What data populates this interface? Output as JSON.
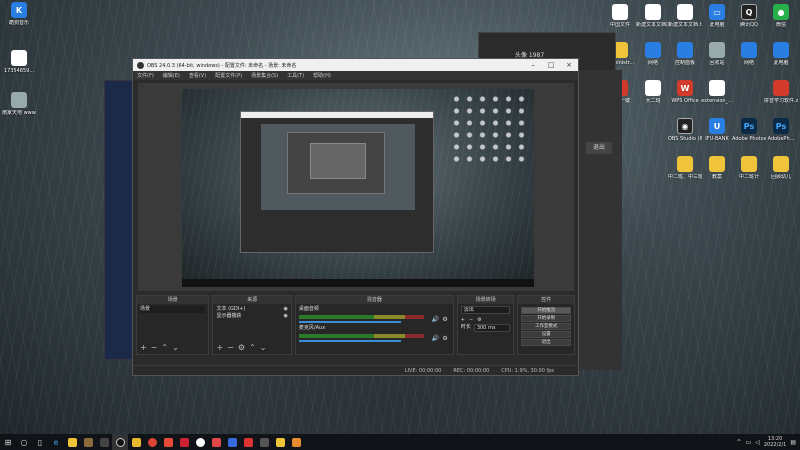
{
  "desktop": {
    "left_icons": [
      {
        "name": "kugou-icon",
        "label": "酷狗音乐",
        "glyph": "K",
        "style": "g-blue"
      },
      {
        "name": "file-icon",
        "label": "17354859...",
        "glyph": "",
        "style": "g-doc"
      },
      {
        "name": "image-icon",
        "label": "雨家天地 www.dyfl...",
        "glyph": "",
        "style": "g-gray"
      }
    ],
    "right_icons": [
      {
        "name": "doc1",
        "label": "中国文件",
        "glyph": "",
        "style": "g-doc"
      },
      {
        "name": "doc2",
        "label": "新建文本文档(3).txt",
        "glyph": "",
        "style": "g-doc"
      },
      {
        "name": "doc3",
        "label": "新建文本文档.txt",
        "glyph": "",
        "style": "g-doc"
      },
      {
        "name": "pc",
        "label": "此电脑",
        "glyph": "▭",
        "style": "g-blue"
      },
      {
        "name": "qq",
        "label": "腾讯QQ",
        "glyph": "Q",
        "style": "g-dark"
      },
      {
        "name": "wechat",
        "label": "微信",
        "glyph": "●",
        "style": "g-green"
      },
      {
        "name": "ws1",
        "label": "Administr...",
        "glyph": "",
        "style": "g-yellow"
      },
      {
        "name": "ws2",
        "label": "网络",
        "glyph": "",
        "style": "g-blue"
      },
      {
        "name": "ws3",
        "label": "控制面板",
        "glyph": "",
        "style": "g-blue"
      },
      {
        "name": "ws4",
        "label": "回收站",
        "glyph": "",
        "style": "g-gray"
      },
      {
        "name": "ws5",
        "label": "网络",
        "glyph": "",
        "style": "g-blue"
      },
      {
        "name": "ws6",
        "label": "此电脑",
        "glyph": "",
        "style": "g-blue"
      },
      {
        "name": "ws7",
        "label": "小白一键",
        "glyph": "",
        "style": "g-red"
      },
      {
        "name": "ws8",
        "label": "大二班",
        "glyph": "",
        "style": "g-doc"
      },
      {
        "name": "ws9",
        "label": "WPS Office",
        "glyph": "W",
        "style": "g-red"
      },
      {
        "name": "ws10",
        "label": "extension_...",
        "glyph": "",
        "style": "g-doc"
      },
      {
        "name": "ws11",
        "label": "拼音学习软件.zip",
        "glyph": "",
        "style": "g-red"
      },
      {
        "name": "ws12",
        "label": "OBS Studio (64bit)",
        "glyph": "◉",
        "style": "g-dark"
      },
      {
        "name": "ws13",
        "label": "IFU-BANK",
        "glyph": "U",
        "style": "g-blue"
      },
      {
        "name": "ws14",
        "label": "Adobe Photosh...",
        "glyph": "Ps",
        "style": "g-ps"
      },
      {
        "name": "ws15",
        "label": "AdobePh...",
        "glyph": "Ps",
        "style": "g-ps"
      },
      {
        "name": "ws16",
        "label": "中二班、中三班周重计",
        "glyph": "",
        "style": "g-yellow"
      },
      {
        "name": "ws17",
        "label": "教案",
        "glyph": "",
        "style": "g-yellow"
      },
      {
        "name": "ws18",
        "label": "中二班计",
        "glyph": "",
        "style": "g-yellow"
      },
      {
        "name": "ws19",
        "label": "回顾幼儿",
        "glyph": "",
        "style": "g-yellow"
      }
    ]
  },
  "back_window": {
    "username": "头像 1987",
    "exit_label": "退出"
  },
  "obs": {
    "title": "OBS 24.0.3 (64-bit, windows) - 配置文件: 未命名 - 场景: 未命名",
    "menu": [
      "文件(F)",
      "编辑(E)",
      "查看(V)",
      "配置文件(P)",
      "场景集合(S)",
      "工具(T)",
      "帮助(H)"
    ],
    "docks": {
      "scenes": {
        "title": "场景",
        "items": [
          "场景"
        ]
      },
      "sources": {
        "title": "来源",
        "items": [
          "文本 (GDI+)",
          "显示器捕获"
        ]
      },
      "mixer": {
        "title": "混音器",
        "channels": [
          {
            "name": "桌面音频"
          },
          {
            "name": "麦克风/Aux"
          }
        ]
      },
      "transitions": {
        "title": "场景转场",
        "selected": "淡出",
        "duration_label": "时长",
        "duration_value": "300 ms"
      },
      "controls": {
        "title": "控件",
        "buttons": [
          "开始推流",
          "开始录制",
          "工作室模式",
          "设置",
          "退出"
        ]
      }
    },
    "status": {
      "live": "LIVE: 00:00:00",
      "rec": "REC: 00:00:00",
      "cpu": "CPU: 1.9%, 30.00 fps"
    }
  },
  "taskbar": {
    "time": "13:20",
    "date": "2022/2/1"
  }
}
